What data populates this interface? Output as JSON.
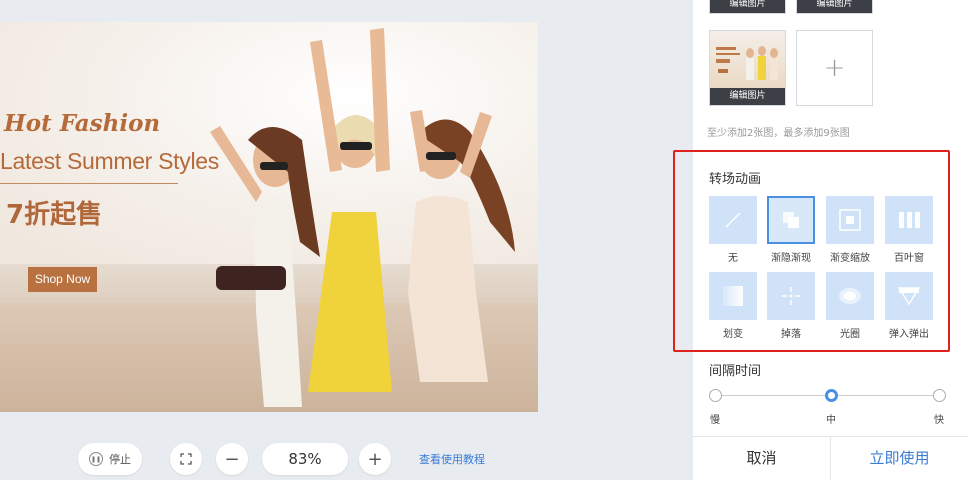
{
  "banner": {
    "headline_1": "Hot Fashion",
    "headline_2": "Latest Summer Styles",
    "headline_3": "7折起售",
    "cta_label": "Shop Now"
  },
  "toolbar": {
    "stop_label": "停止",
    "zoom_level": "83%",
    "zoom_out": "−",
    "zoom_in": "+",
    "tutorial_link": "查看使用教程"
  },
  "panel": {
    "thumbnails": [
      {
        "caption": "编辑图片"
      },
      {
        "caption": "编辑图片"
      },
      {
        "caption": "编辑图片"
      }
    ],
    "add_icon": "+",
    "hint": "至少添加2张图，最多添加9张图",
    "transition": {
      "title": "转场动画",
      "selected": "渐隐渐现",
      "items": [
        {
          "label": "无",
          "icon": "slash-icon"
        },
        {
          "label": "渐隐渐现",
          "icon": "fade-icon"
        },
        {
          "label": "渐变缩放",
          "icon": "zoom-icon"
        },
        {
          "label": "百叶窗",
          "icon": "blinds-icon"
        },
        {
          "label": "划变",
          "icon": "wipe-icon"
        },
        {
          "label": "掉落",
          "icon": "drop-icon"
        },
        {
          "label": "光圈",
          "icon": "iris-icon"
        },
        {
          "label": "弹入弹出",
          "icon": "bounce-icon"
        }
      ]
    },
    "interval": {
      "title": "间隔时间",
      "options": [
        "慢",
        "中",
        "快"
      ],
      "selected": "中"
    },
    "cancel_label": "取消",
    "apply_label": "立即使用"
  },
  "colors": {
    "accent": "#4a90e2",
    "highlight_box": "#e0221f",
    "banner_text": "#b56a3a"
  }
}
